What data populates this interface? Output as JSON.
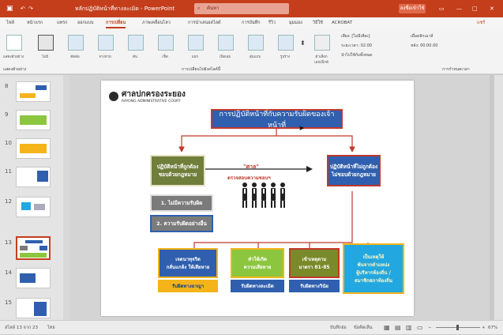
{
  "window": {
    "title": "หลักปฏิบัติหน้าที่ทางละเมิด - PowerPoint",
    "search_placeholder": "ค้นหา",
    "user_button": "ลงชื่อเข้าใช้",
    "share_label": "แชร์"
  },
  "tabs": [
    "ไฟล์",
    "หน้าแรก",
    "แทรก",
    "ออกแบบ",
    "การเปลี่ยน",
    "ภาพเคลื่อนไหว",
    "การนำเสนอสไลด์",
    "การบันทึก",
    "รีวิว",
    "มุมมอง",
    "วิธีใช้",
    "ACROBAT"
  ],
  "active_tab": "การเปลี่ยน",
  "ribbon": {
    "preview_label": "แสดงตัวอย่าง",
    "transitions": [
      "ไม่มี",
      "ตัดต่อ",
      "จางหาย",
      "ดัน",
      "เช็ด",
      "แยก",
      "เปิดเผย",
      "สุ่มแถบ",
      "รูปร่าง"
    ],
    "effect_options": "ตัวเลือกเอฟเฟ็กต์",
    "sound_label": "เสียง: [ไม่มีเสียง]",
    "duration_label": "ระยะเวลา: 02.00",
    "apply_all": "นำไปใช้กับทั้งหมด",
    "on_click": "เมื่อคลิกเมาส์",
    "after": "หลัง: 00:00.00",
    "group_transition": "การเปลี่ยนไปยังสไลด์นี้",
    "group_timing": "การกำหนดเวลา",
    "group_preview": "แสดงตัวอย่าง"
  },
  "slides_panel": {
    "numbers": [
      "8",
      "9",
      "10",
      "11",
      "12",
      "13",
      "14",
      "15"
    ],
    "selected": "13"
  },
  "slide": {
    "org_name": "ศาลปกครองระยอง",
    "org_name_en": "RAYONG ADMINISTRATIVE COURT",
    "main_title": "การปฏิบัติหน้าที่กับความรับผิดของเจ้าหน้าที่",
    "left_box": "ปฏิบัติหน้าที่ถูกต้อง\nชอบด้วยกฎหมาย",
    "right_box": "ปฏิบัติหน้าที่ไม่ถูกต้อง\nไม่ชอบด้วยกฎหมาย",
    "court_label": "\"ศาล\"",
    "check_label": "ตรวจสอบความชอบฯ",
    "no_liability": "1. ไม่มีความรับผิด",
    "other_liability": "2. ความรับผิดอย่างอื่น",
    "box_intent": "เจตนาทุจริต\nกลั่นแกล้ง ให้เสียหาย",
    "box_intent_sub": "รับผิดทางอาญา",
    "box_damage": "ทำให้เกิด\nความเสียหาย",
    "box_damage_sub": "รับผิดทางละเมิด",
    "box_discipline": "เข้าเหตุตาม\nมาตรา 81-85",
    "box_discipline_sub": "รับผิดทางวินัย",
    "box_reason": "เป็นเหตุให้\nพ้นจากตำแหน่ง\nผู้บริหารท้องถิ่น /\nสมาชิกสภาท้องถิ่น"
  },
  "status": {
    "slide_count": "สไลด์ 13 จาก 23",
    "language": "ไทย",
    "notes": "บันทึกย่อ",
    "comments": "ข้อคิดเห็น",
    "zoom": "67%"
  },
  "colors": {
    "accent": "#c43e1c",
    "title_blue": "#2f5fae",
    "connector_red": "#c0392b",
    "olive": "#6f7e3a",
    "gray_box": "#7b7b7b",
    "orange_box": "#f4b41a",
    "green_box": "#8cc63f",
    "cyan_box": "#23a7e0"
  }
}
